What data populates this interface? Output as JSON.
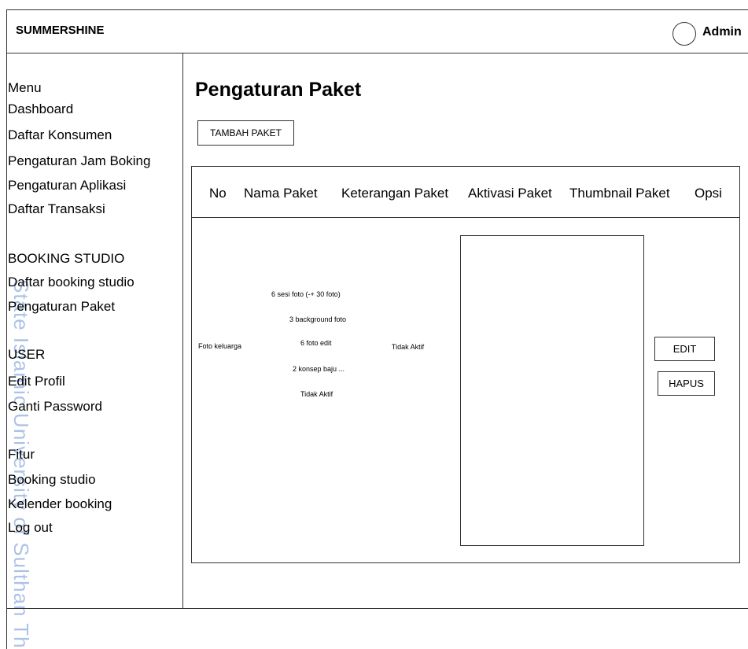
{
  "header": {
    "brand": "SUMMERSHINE",
    "user": "Admin"
  },
  "sidebar": {
    "menu_title": "Menu",
    "menu_items": [
      "Dashboard",
      "Daftar Konsumen",
      "Pengaturan Jam Boking",
      "Pengaturan Aplikasi",
      "Daftar Transaksi"
    ],
    "booking_title": "BOOKING STUDIO",
    "booking_items": [
      "Daftar booking studio",
      "Pengaturan Paket"
    ],
    "user_title": "USER",
    "user_items": [
      "Edit Profil",
      "Ganti Password"
    ],
    "fitur_title": "Fitur",
    "fitur_items": [
      "Booking studio",
      "Kelender booking",
      "Log out"
    ]
  },
  "watermark": "State Islamic University of Sulthan Th",
  "main": {
    "title": "Pengaturan Paket",
    "add_button": "TAMBAH PAKET",
    "columns": [
      "No",
      "Nama Paket",
      "Keterangan Paket",
      "Aktivasi Paket",
      "Thumbnail Paket",
      "Opsi"
    ],
    "row": {
      "name": "Foto keluarga",
      "description_lines": [
        "6 sesi foto (-+ 30 foto)",
        "3 background foto",
        "6 foto edit",
        "2 konsep baju ...",
        "Tidak Aktif"
      ],
      "status": "Tidak Aktif",
      "edit_button": "EDIT",
      "delete_button": "HAPUS"
    }
  }
}
